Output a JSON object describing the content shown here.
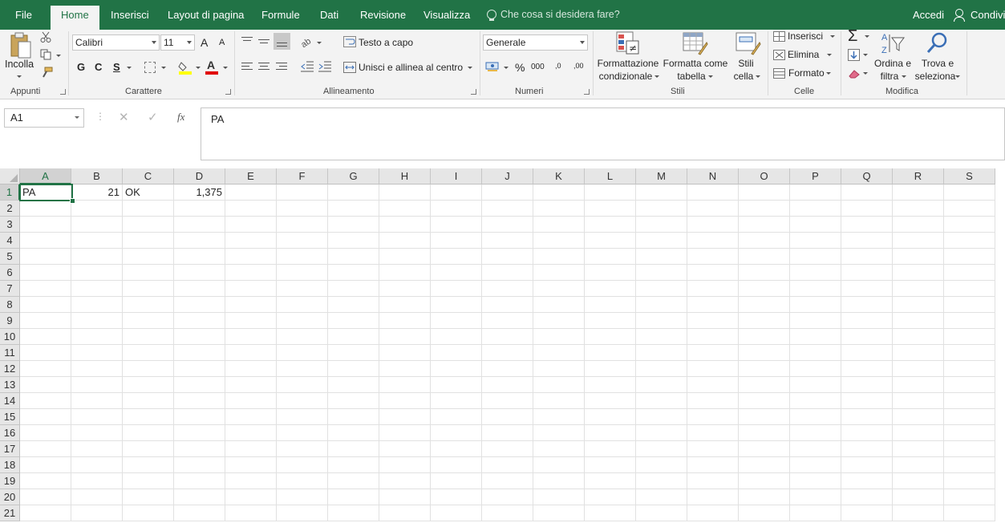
{
  "tabs": {
    "file": "File",
    "home": "Home",
    "insert": "Inserisci",
    "layout": "Layout di pagina",
    "formulas": "Formule",
    "data": "Dati",
    "review": "Revisione",
    "view": "Visualizza",
    "tell_me": "Che cosa si desidera fare?",
    "sign_in": "Accedi",
    "share": "Condividi"
  },
  "ribbon": {
    "clipboard": {
      "paste": "Incolla",
      "label": "Appunti"
    },
    "font": {
      "name": "Calibri",
      "size": "11",
      "bold": "G",
      "italic": "C",
      "underline": "S",
      "grow": "A",
      "shrink": "A",
      "font_color_glyph": "A",
      "label": "Carattere"
    },
    "alignment": {
      "wrap": "Testo a capo",
      "merge": "Unisci e allinea al centro",
      "label": "Allineamento"
    },
    "number": {
      "format": "Generale",
      "percent": "%",
      "thousands": "000",
      "inc_decimal": ",0",
      "dec_decimal": ",00",
      "label": "Numeri"
    },
    "styles": {
      "conditional_1": "Formattazione",
      "conditional_2": "condizionale",
      "table_1": "Formatta come",
      "table_2": "tabella",
      "cell_1": "Stili",
      "cell_2": "cella",
      "label": "Stili"
    },
    "cells": {
      "insert": "Inserisci",
      "delete": "Elimina",
      "format": "Formato",
      "label": "Celle"
    },
    "editing": {
      "sort_1": "Ordina e",
      "sort_2": "filtra",
      "find_1": "Trova e",
      "find_2": "seleziona",
      "label": "Modifica"
    }
  },
  "formula_bar": {
    "name_box": "A1",
    "fx": "fx",
    "content": "PA"
  },
  "sheet": {
    "columns": [
      "A",
      "B",
      "C",
      "D",
      "E",
      "F",
      "G",
      "H",
      "I",
      "J",
      "K",
      "L",
      "M",
      "N",
      "O",
      "P",
      "Q",
      "R",
      "S"
    ],
    "rows": [
      "1",
      "2",
      "3",
      "4",
      "5",
      "6",
      "7",
      "8",
      "9",
      "10",
      "11",
      "12",
      "13",
      "14",
      "15",
      "16",
      "17",
      "18",
      "19",
      "20",
      "21"
    ],
    "cells": {
      "A1": "PA",
      "B1": "21",
      "C1": "OK",
      "D1": "1,375"
    }
  },
  "colors": {
    "accent": "#217346",
    "ribbon_bg": "#f3f3f3",
    "header_bg": "#e6e6e6"
  }
}
